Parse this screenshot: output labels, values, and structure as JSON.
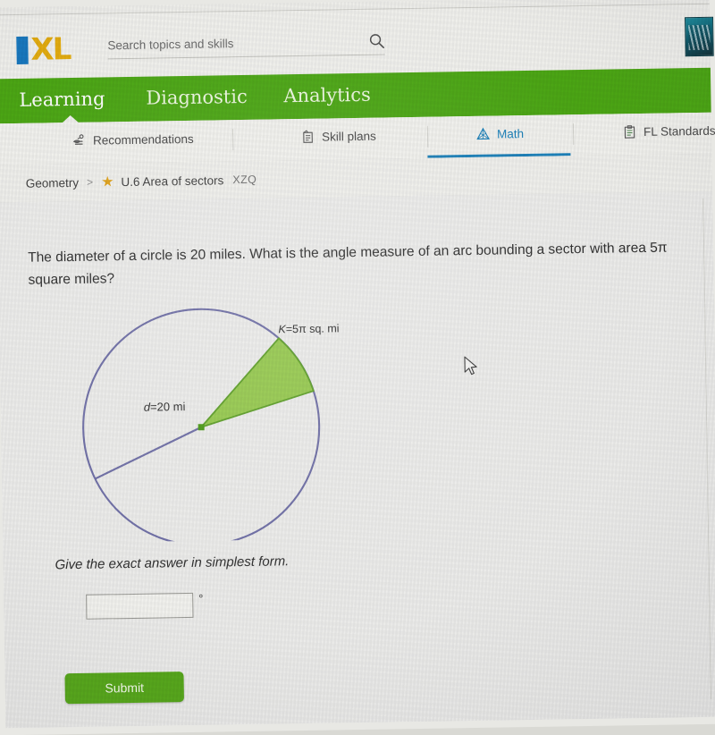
{
  "header": {
    "logo_i": "I",
    "logo_xl": "XL",
    "search": {
      "placeholder": "Search topics and skills",
      "value": "",
      "icon": "search-icon"
    },
    "avatar_icon": "avatar-thumbnail"
  },
  "primary_nav": {
    "items": [
      {
        "label": "Learning",
        "active": true
      },
      {
        "label": "Diagnostic",
        "active": false
      },
      {
        "label": "Analytics",
        "active": false
      }
    ]
  },
  "sub_nav": {
    "items": [
      {
        "label": "Recommendations",
        "icon": "recommendations-icon",
        "active": false
      },
      {
        "label": "Skill plans",
        "icon": "skill-plans-icon",
        "active": false
      },
      {
        "label": "Math",
        "icon": "math-pyramid-icon",
        "active": true
      },
      {
        "label": "FL Standards",
        "icon": "standards-clipboard-icon",
        "active": false
      }
    ]
  },
  "breadcrumb": {
    "subject": "Geometry",
    "separator": ">",
    "star_icon": "star-icon",
    "skill": "U.6 Area of sectors",
    "skill_code": "XZQ"
  },
  "question": {
    "text": "The diameter of a circle is 20 miles. What is the angle measure of an arc bounding a sector with area 5π square miles?",
    "instruction": "Give the exact answer in simplest form."
  },
  "diagram": {
    "type": "circle-sector",
    "circle_stroke": "#6f6fa6",
    "sector_fill": "#8dc63f",
    "sector_stroke": "#5a9e24",
    "center_dot_color": "#4a9a16",
    "sector_label": "K=5π sq. mi",
    "sector_label_italic_part": "K",
    "diameter_label": "d=20 mi",
    "diameter_label_italic_part": "d",
    "sector_start_angle_deg": 17,
    "sector_end_angle_deg": 48,
    "diameter_angle_deg": 205
  },
  "answer": {
    "value": "",
    "unit_symbol": "°"
  },
  "actions": {
    "submit_label": "Submit",
    "submit_color": "#57a81b"
  }
}
